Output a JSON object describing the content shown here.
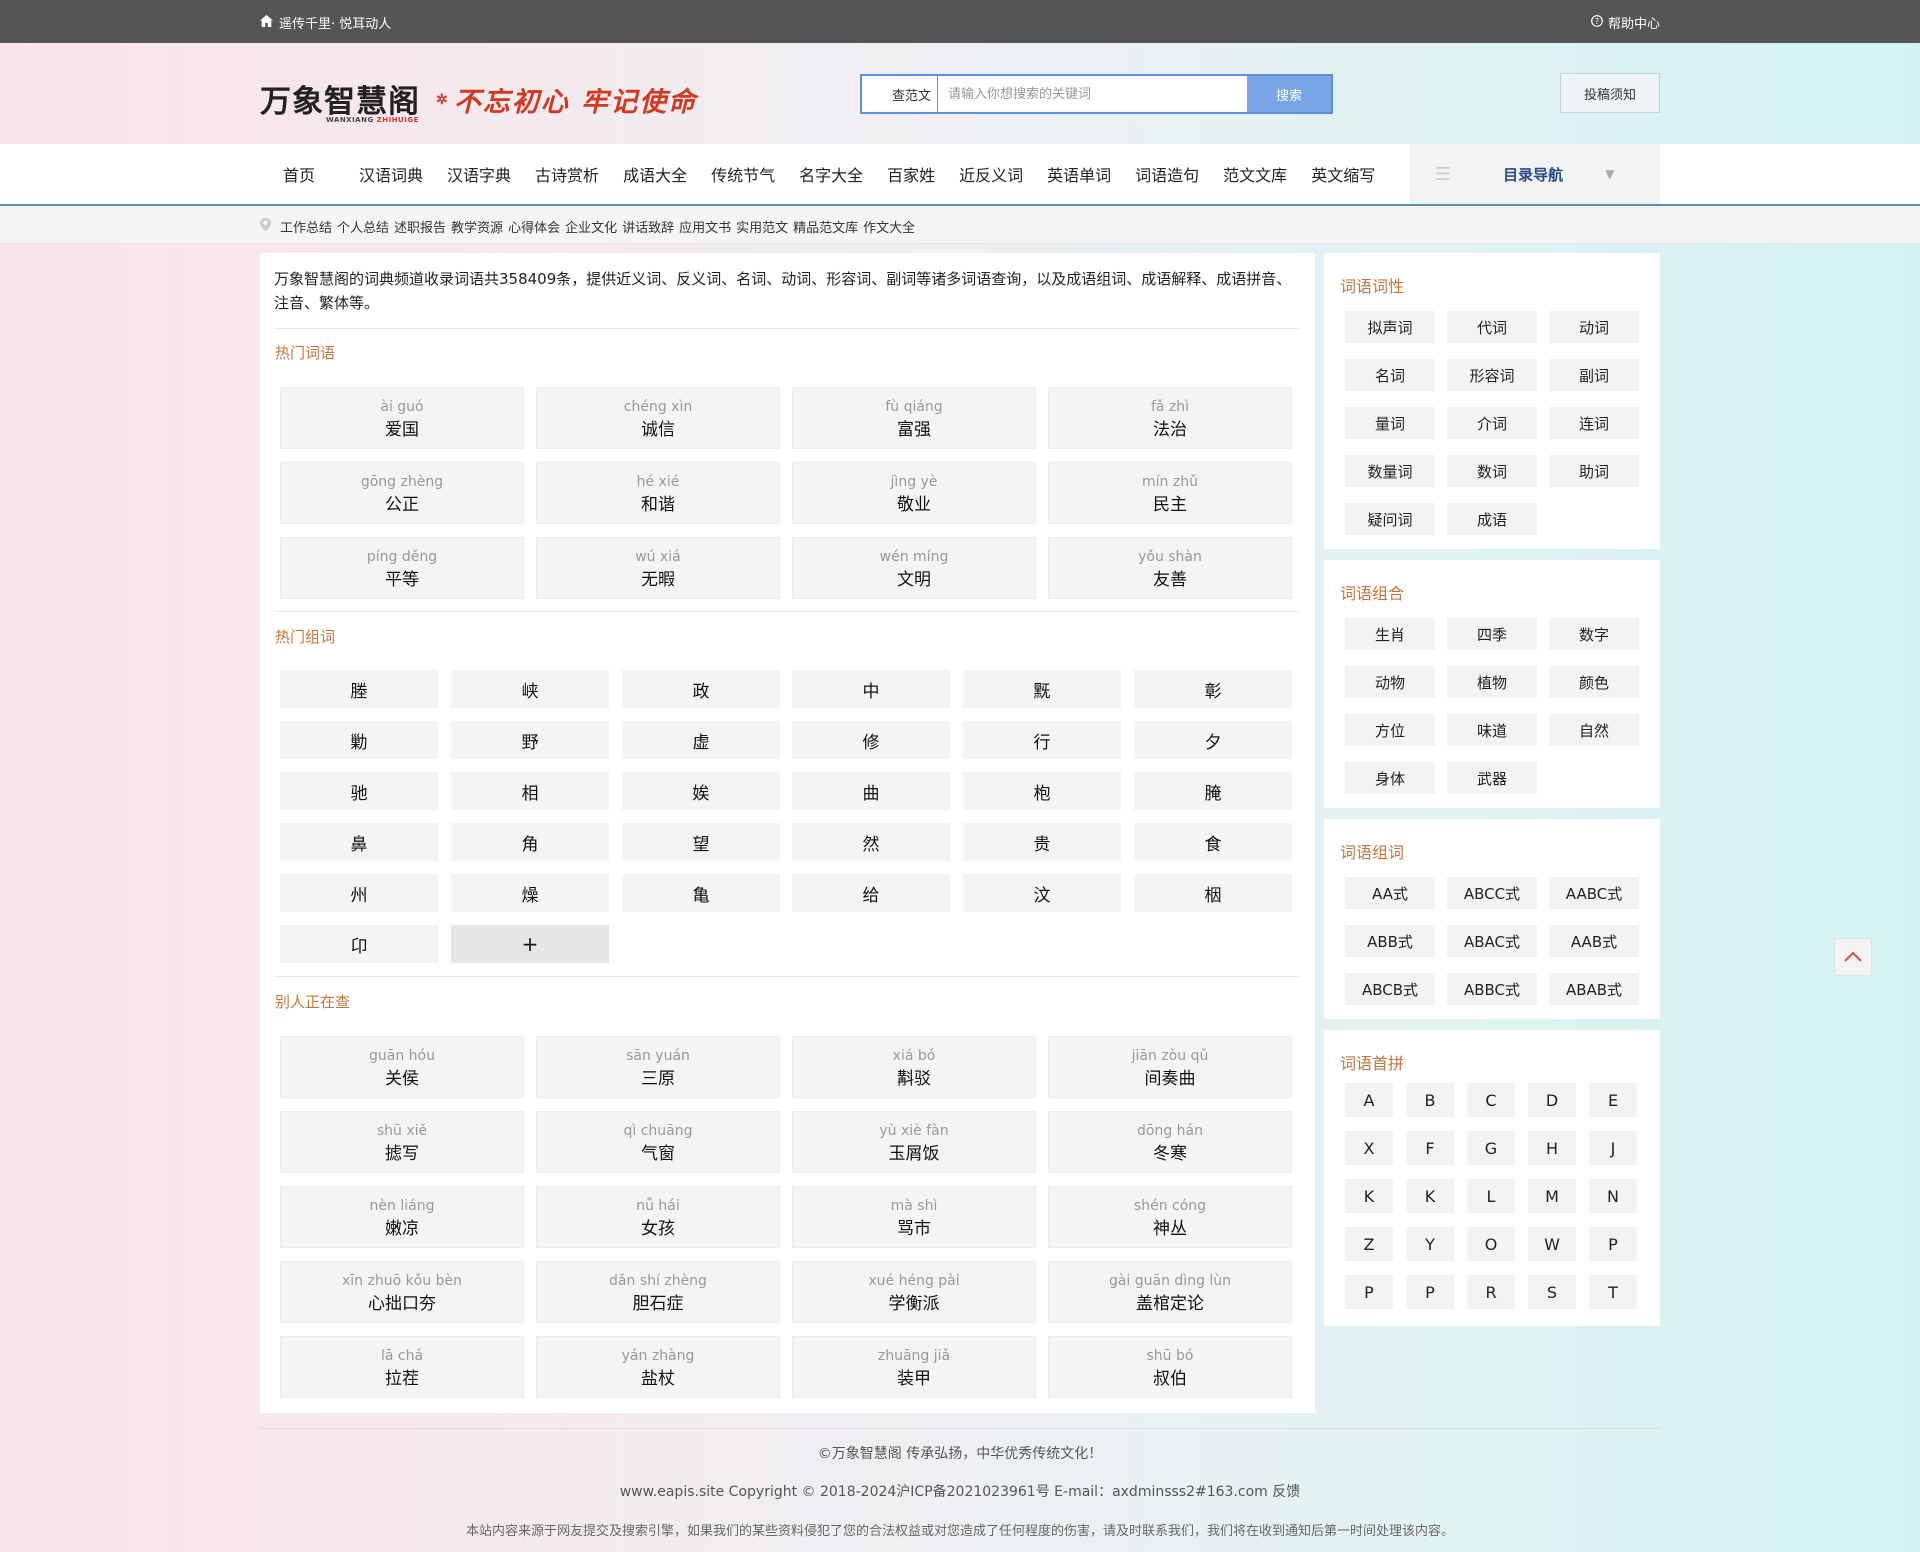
{
  "topbar": {
    "left_text": "遥传千里· 悦耳动人",
    "right_text": "帮助中心"
  },
  "header": {
    "logo": "万象智慧阁",
    "logo_sub_a": "WANXIANG ",
    "logo_sub_b": "ZHIHUIGE",
    "slogan": "不忘初心 牢记使命",
    "search_category": "查范文",
    "search_placeholder": "请输入你想搜索的关键词",
    "search_button": "搜索",
    "submit_note": "投稿须知"
  },
  "nav": {
    "items": [
      "首页",
      "汉语词典",
      "汉语字典",
      "古诗赏析",
      "成语大全",
      "传统节气",
      "名字大全",
      "百家姓",
      "近反义词",
      "英语单词",
      "词语造句",
      "范文文库",
      "英文缩写"
    ],
    "catalog": "目录导航"
  },
  "subnav": [
    "工作总结",
    "个人总结",
    "述职报告",
    "教学资源",
    "心得体会",
    "企业文化",
    "讲话致辞",
    "应用文书",
    "实用范文",
    "精品范文库",
    "作文大全"
  ],
  "intro": "万象智慧阁的词典频道收录词语共358409条，提供近义词、反义词、名词、动词、形容词、副词等诸多词语查询，以及成语组词、成语解释、成语拼音、注音、繁体等。",
  "hot_words": {
    "title": "热门词语",
    "items": [
      {
        "py": "ài guó",
        "w": "爱国"
      },
      {
        "py": "chéng xìn",
        "w": "诚信"
      },
      {
        "py": "fù qiáng",
        "w": "富强"
      },
      {
        "py": "fǎ zhì",
        "w": "法治"
      },
      {
        "py": "gōng zhèng",
        "w": "公正"
      },
      {
        "py": "hé xié",
        "w": "和谐"
      },
      {
        "py": "jìng yè",
        "w": "敬业"
      },
      {
        "py": "mín zhǔ",
        "w": "民主"
      },
      {
        "py": "píng děng",
        "w": "平等"
      },
      {
        "py": "wú xiá",
        "w": "无暇"
      },
      {
        "py": "wén míng",
        "w": "文明"
      },
      {
        "py": "yǒu shàn",
        "w": "友善"
      }
    ]
  },
  "hot_chars": {
    "title": "热门组词",
    "items": [
      "塍",
      "峡",
      "政",
      "中",
      "黖",
      "彰",
      "勦",
      "野",
      "虚",
      "修",
      "行",
      "夕",
      "驰",
      "相",
      "娭",
      "曲",
      "枹",
      "腌",
      "鼻",
      "角",
      "望",
      "然",
      "贵",
      "食",
      "州",
      "燥",
      "亀",
      "给",
      "汶",
      "栶",
      "卬"
    ],
    "more": "+"
  },
  "others": {
    "title": "别人正在查",
    "items": [
      {
        "py": "guān hóu",
        "w": "关侯"
      },
      {
        "py": "sān yuán",
        "w": "三原"
      },
      {
        "py": "xiá bó",
        "w": "斠驳"
      },
      {
        "py": "jiān zòu qǔ",
        "w": "间奏曲"
      },
      {
        "py": "shū xiě",
        "w": "摅写"
      },
      {
        "py": "qì chuāng",
        "w": "气窗"
      },
      {
        "py": "yù xiè fàn",
        "w": "玉屑饭"
      },
      {
        "py": "dōng hán",
        "w": "冬寒"
      },
      {
        "py": "nèn liáng",
        "w": "嫩凉"
      },
      {
        "py": "nǚ hái",
        "w": "女孩"
      },
      {
        "py": "mà shì",
        "w": "骂市"
      },
      {
        "py": "shén cóng",
        "w": "神丛"
      },
      {
        "py": "xīn zhuō kǒu bèn",
        "w": "心拙口夯"
      },
      {
        "py": "dǎn shí zhèng",
        "w": "胆石症"
      },
      {
        "py": "xué héng pài",
        "w": "学衡派"
      },
      {
        "py": "gài guān dìng lùn",
        "w": "盖棺定论"
      },
      {
        "py": "lā chá",
        "w": "拉茬"
      },
      {
        "py": "yán zhàng",
        "w": "盐杖"
      },
      {
        "py": "zhuāng jiǎ",
        "w": "装甲"
      },
      {
        "py": "shū bó",
        "w": "叔伯"
      }
    ]
  },
  "side_pos": {
    "title": "词语词性",
    "items": [
      "拟声词",
      "代词",
      "动词",
      "名词",
      "形容词",
      "副词",
      "量词",
      "介词",
      "连词",
      "数量词",
      "数词",
      "助词",
      "疑问词",
      "成语"
    ]
  },
  "side_combo": {
    "title": "词语组合",
    "items": [
      "生肖",
      "四季",
      "数字",
      "动物",
      "植物",
      "颜色",
      "方位",
      "味道",
      "自然",
      "身体",
      "武器"
    ]
  },
  "side_pattern": {
    "title": "词语组词",
    "items": [
      "AA式",
      "ABCC式",
      "AABC式",
      "ABB式",
      "ABAC式",
      "AAB式",
      "ABCB式",
      "ABBC式",
      "ABAB式"
    ]
  },
  "side_initial": {
    "title": "词语首拼",
    "items": [
      "A",
      "B",
      "C",
      "D",
      "E",
      "X",
      "F",
      "G",
      "H",
      "J",
      "K",
      "K",
      "L",
      "M",
      "N",
      "Z",
      "Y",
      "O",
      "W",
      "P",
      "P",
      "P",
      "R",
      "S",
      "T"
    ]
  },
  "footer": {
    "line1": "©万象智慧阁 传承弘扬，中华优秀传统文化！",
    "line2": "www.eapis.site Copyright © 2018-2024沪ICP备2021023961号 E-mail：axdminsss2#163.com 反馈",
    "line3": "本站内容来源于网友提交及搜索引擎，如果我们的某些资料侵犯了您的合法权益或对您造成了任何程度的伤害，请及时联系我们，我们将在收到通知后第一时间处理该内容。"
  },
  "colors": {
    "accent": "#c5753b",
    "nav_border": "#5b8ac6",
    "search_btn": "#77a5e6",
    "topbar": "#555555"
  }
}
